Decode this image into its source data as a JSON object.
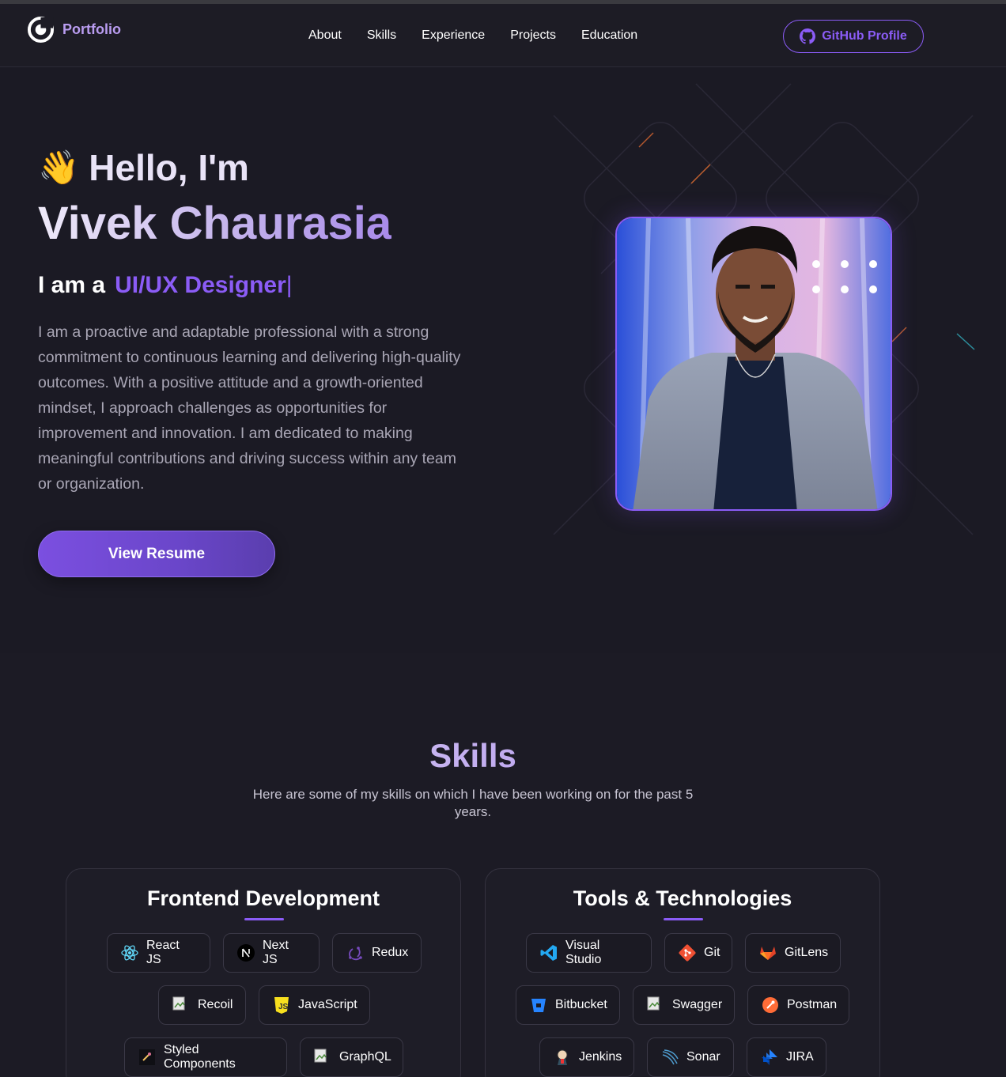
{
  "nav": {
    "logo_text": "Portfolio",
    "links": [
      "About",
      "Skills",
      "Experience",
      "Projects",
      "Education"
    ],
    "github_label": "GitHub Profile"
  },
  "hero": {
    "wave_emoji": "👋",
    "greeting": "Hello, I'm",
    "name": "Vivek Chaurasia",
    "role_prefix": "I am a",
    "role": "UI/UX Designer",
    "cursor": "|",
    "bio": "I am a proactive and adaptable professional with a strong commitment to continuous learning and delivering high-quality outcomes. With a positive attitude and a growth-oriented mindset, I approach challenges as opportunities for improvement and innovation. I am dedicated to making meaningful contributions and driving success within any team or organization.",
    "resume_label": "View Resume"
  },
  "skills": {
    "title": "Skills",
    "subtitle": "Here are some of my skills on which I have been working on for the past 5 years.",
    "frontend": {
      "title": "Frontend Development",
      "items": [
        "React JS",
        "Next JS",
        "Redux",
        "Recoil",
        "JavaScript",
        "Styled Components",
        "GraphQL"
      ]
    },
    "tools": {
      "title": "Tools & Technologies",
      "items": [
        "Visual Studio",
        "Git",
        "GitLens",
        "Bitbucket",
        "Swagger",
        "Postman",
        "Jenkins",
        "Sonar",
        "JIRA"
      ]
    }
  },
  "colors": {
    "accent": "#8b5cf6",
    "background": "#1c1b25",
    "text_muted": "#a9a6b5"
  }
}
